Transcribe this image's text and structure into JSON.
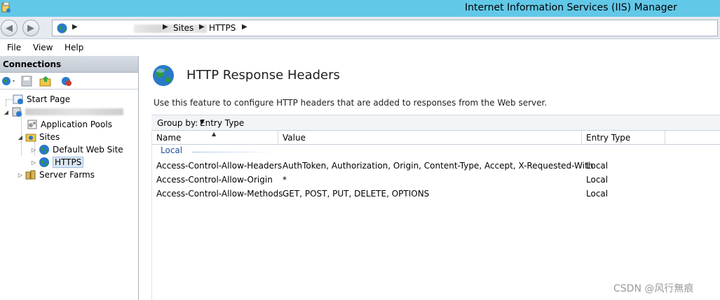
{
  "window": {
    "title": "Internet Information Services (IIS) Manager"
  },
  "address_bar": {
    "breadcrumbs": [
      "Sites",
      "HTTPS"
    ]
  },
  "menu": {
    "items": [
      {
        "label": "File"
      },
      {
        "label": "View"
      },
      {
        "label": "Help"
      }
    ]
  },
  "connections": {
    "header": "Connections",
    "tree": [
      {
        "label": "Start Page",
        "icon": "start-page-icon"
      },
      {
        "label": "",
        "icon": "server-icon"
      },
      {
        "label": "Application Pools",
        "icon": "app-pools-icon"
      },
      {
        "label": "Sites",
        "icon": "sites-folder-icon"
      },
      {
        "label": "Default Web Site",
        "icon": "globe-icon"
      },
      {
        "label": "HTTPS",
        "icon": "globe-icon",
        "selected": true
      },
      {
        "label": "Server Farms",
        "icon": "server-farms-icon"
      }
    ]
  },
  "main": {
    "title": "HTTP Response Headers",
    "description": "Use this feature to configure HTTP headers that are added to responses from the Web server.",
    "group_by_label": "Group by:",
    "group_by_value": "Entry Type",
    "columns": [
      "Name",
      "Value",
      "Entry Type"
    ],
    "group_name": "Local",
    "rows": [
      {
        "name": "Access-Control-Allow-Headers",
        "value": "AuthToken, Authorization, Origin, Content-Type, Accept, X-Requested-With",
        "type": "Local"
      },
      {
        "name": "Access-Control-Allow-Origin",
        "value": "*",
        "type": "Local"
      },
      {
        "name": "Access-Control-Allow-Methods",
        "value": "GET, POST, PUT, DELETE, OPTIONS",
        "type": "Local"
      }
    ]
  },
  "watermark": "CSDN @风行無痕",
  "colors": {
    "titlebar": "#62c8e8",
    "group_text": "#1f4e9c",
    "selection": "#dbe7f4"
  }
}
